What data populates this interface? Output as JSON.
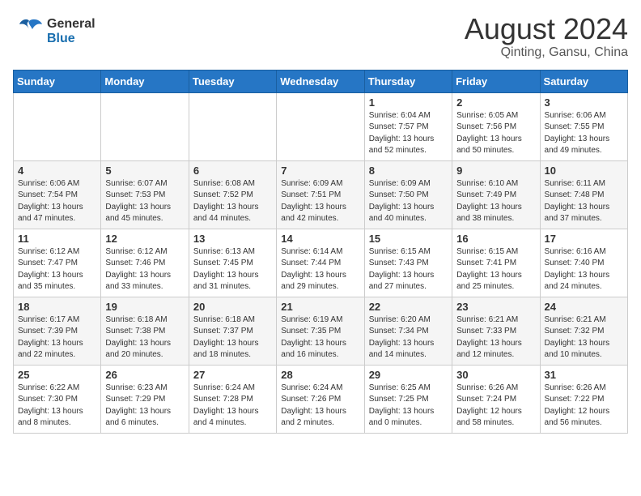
{
  "header": {
    "logo_general": "General",
    "logo_blue": "Blue",
    "month_title": "August 2024",
    "location": "Qinting, Gansu, China"
  },
  "weekdays": [
    "Sunday",
    "Monday",
    "Tuesday",
    "Wednesday",
    "Thursday",
    "Friday",
    "Saturday"
  ],
  "weeks": [
    [
      {
        "day": "",
        "info": ""
      },
      {
        "day": "",
        "info": ""
      },
      {
        "day": "",
        "info": ""
      },
      {
        "day": "",
        "info": ""
      },
      {
        "day": "1",
        "info": "Sunrise: 6:04 AM\nSunset: 7:57 PM\nDaylight: 13 hours\nand 52 minutes."
      },
      {
        "day": "2",
        "info": "Sunrise: 6:05 AM\nSunset: 7:56 PM\nDaylight: 13 hours\nand 50 minutes."
      },
      {
        "day": "3",
        "info": "Sunrise: 6:06 AM\nSunset: 7:55 PM\nDaylight: 13 hours\nand 49 minutes."
      }
    ],
    [
      {
        "day": "4",
        "info": "Sunrise: 6:06 AM\nSunset: 7:54 PM\nDaylight: 13 hours\nand 47 minutes."
      },
      {
        "day": "5",
        "info": "Sunrise: 6:07 AM\nSunset: 7:53 PM\nDaylight: 13 hours\nand 45 minutes."
      },
      {
        "day": "6",
        "info": "Sunrise: 6:08 AM\nSunset: 7:52 PM\nDaylight: 13 hours\nand 44 minutes."
      },
      {
        "day": "7",
        "info": "Sunrise: 6:09 AM\nSunset: 7:51 PM\nDaylight: 13 hours\nand 42 minutes."
      },
      {
        "day": "8",
        "info": "Sunrise: 6:09 AM\nSunset: 7:50 PM\nDaylight: 13 hours\nand 40 minutes."
      },
      {
        "day": "9",
        "info": "Sunrise: 6:10 AM\nSunset: 7:49 PM\nDaylight: 13 hours\nand 38 minutes."
      },
      {
        "day": "10",
        "info": "Sunrise: 6:11 AM\nSunset: 7:48 PM\nDaylight: 13 hours\nand 37 minutes."
      }
    ],
    [
      {
        "day": "11",
        "info": "Sunrise: 6:12 AM\nSunset: 7:47 PM\nDaylight: 13 hours\nand 35 minutes."
      },
      {
        "day": "12",
        "info": "Sunrise: 6:12 AM\nSunset: 7:46 PM\nDaylight: 13 hours\nand 33 minutes."
      },
      {
        "day": "13",
        "info": "Sunrise: 6:13 AM\nSunset: 7:45 PM\nDaylight: 13 hours\nand 31 minutes."
      },
      {
        "day": "14",
        "info": "Sunrise: 6:14 AM\nSunset: 7:44 PM\nDaylight: 13 hours\nand 29 minutes."
      },
      {
        "day": "15",
        "info": "Sunrise: 6:15 AM\nSunset: 7:43 PM\nDaylight: 13 hours\nand 27 minutes."
      },
      {
        "day": "16",
        "info": "Sunrise: 6:15 AM\nSunset: 7:41 PM\nDaylight: 13 hours\nand 25 minutes."
      },
      {
        "day": "17",
        "info": "Sunrise: 6:16 AM\nSunset: 7:40 PM\nDaylight: 13 hours\nand 24 minutes."
      }
    ],
    [
      {
        "day": "18",
        "info": "Sunrise: 6:17 AM\nSunset: 7:39 PM\nDaylight: 13 hours\nand 22 minutes."
      },
      {
        "day": "19",
        "info": "Sunrise: 6:18 AM\nSunset: 7:38 PM\nDaylight: 13 hours\nand 20 minutes."
      },
      {
        "day": "20",
        "info": "Sunrise: 6:18 AM\nSunset: 7:37 PM\nDaylight: 13 hours\nand 18 minutes."
      },
      {
        "day": "21",
        "info": "Sunrise: 6:19 AM\nSunset: 7:35 PM\nDaylight: 13 hours\nand 16 minutes."
      },
      {
        "day": "22",
        "info": "Sunrise: 6:20 AM\nSunset: 7:34 PM\nDaylight: 13 hours\nand 14 minutes."
      },
      {
        "day": "23",
        "info": "Sunrise: 6:21 AM\nSunset: 7:33 PM\nDaylight: 13 hours\nand 12 minutes."
      },
      {
        "day": "24",
        "info": "Sunrise: 6:21 AM\nSunset: 7:32 PM\nDaylight: 13 hours\nand 10 minutes."
      }
    ],
    [
      {
        "day": "25",
        "info": "Sunrise: 6:22 AM\nSunset: 7:30 PM\nDaylight: 13 hours\nand 8 minutes."
      },
      {
        "day": "26",
        "info": "Sunrise: 6:23 AM\nSunset: 7:29 PM\nDaylight: 13 hours\nand 6 minutes."
      },
      {
        "day": "27",
        "info": "Sunrise: 6:24 AM\nSunset: 7:28 PM\nDaylight: 13 hours\nand 4 minutes."
      },
      {
        "day": "28",
        "info": "Sunrise: 6:24 AM\nSunset: 7:26 PM\nDaylight: 13 hours\nand 2 minutes."
      },
      {
        "day": "29",
        "info": "Sunrise: 6:25 AM\nSunset: 7:25 PM\nDaylight: 13 hours\nand 0 minutes."
      },
      {
        "day": "30",
        "info": "Sunrise: 6:26 AM\nSunset: 7:24 PM\nDaylight: 12 hours\nand 58 minutes."
      },
      {
        "day": "31",
        "info": "Sunrise: 6:26 AM\nSunset: 7:22 PM\nDaylight: 12 hours\nand 56 minutes."
      }
    ]
  ]
}
